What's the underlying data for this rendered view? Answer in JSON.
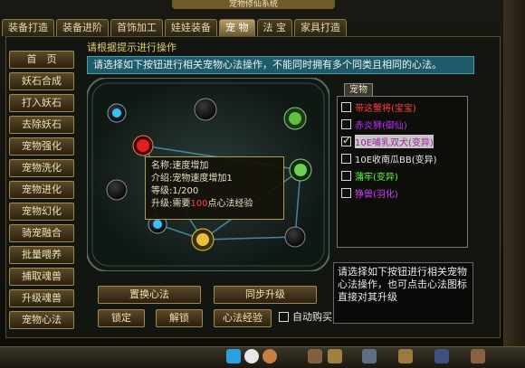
{
  "window": {
    "title": "宠物修仙系统"
  },
  "tabs": [
    {
      "label": "装备打造",
      "active": false
    },
    {
      "label": "装备进阶",
      "active": false
    },
    {
      "label": "首饰加工",
      "active": false
    },
    {
      "label": "娃娃装备",
      "active": false
    },
    {
      "label": "宠 物",
      "active": true
    },
    {
      "label": "法 宝",
      "active": false
    },
    {
      "label": "家具打造",
      "active": false
    }
  ],
  "hint": {
    "title": "请根据提示进行操作",
    "bar": "请选择如下按钮进行相关宠物心法操作，不能同时拥有多个同类且相同的心法。"
  },
  "left_menu": [
    "首　页",
    "妖石合成",
    "打入妖石",
    "去除妖石",
    "宠物强化",
    "宠物洗化",
    "宠物进化",
    "宠物幻化",
    "骑宠融合",
    "批量喂养",
    "捕取魂兽",
    "升级魂兽",
    "宠物心法"
  ],
  "tooltip": {
    "name_key": "名称:",
    "name_val": "速度增加",
    "intro_key": "介绍:",
    "intro_val": "宠物速度增加1",
    "level_key": "等级:",
    "level_val": "1/200",
    "upgrade_key": "升级:",
    "upgrade_pre": "需要",
    "upgrade_num": "100",
    "upgrade_post": "点心法经验"
  },
  "pet_panel": {
    "tab": "宠物",
    "pets": [
      {
        "name": "带这蟹将(宝宝)",
        "color": "#ff4040",
        "checked": false,
        "selected": false
      },
      {
        "name": "赤炎狮(御仙)",
        "color": "#c030ff",
        "checked": false,
        "selected": false
      },
      {
        "name": "10E哺乳双犬(变异)",
        "color": "#a020a0",
        "checked": true,
        "selected": true
      },
      {
        "name": "10E收南瓜BB(变异)",
        "color": "#e8e8e8",
        "checked": false,
        "selected": false
      },
      {
        "name": "蒲牢(变异)",
        "color": "#60ff40",
        "checked": false,
        "selected": false
      },
      {
        "name": "狰兽(羽化)",
        "color": "#d040ff",
        "checked": false,
        "selected": false
      }
    ]
  },
  "description": "请选择如下按钮进行相关宠物心法操作，也可点击心法图标直接对其升级",
  "buttons": {
    "replace": "置换心法",
    "sync": "同步升级",
    "lock": "锁定",
    "unlock": "解锁",
    "exp": "心法经验",
    "auto_buy": "自动购买"
  },
  "colors": {
    "accent": "#1e5a6a",
    "gold": "#a08850"
  }
}
